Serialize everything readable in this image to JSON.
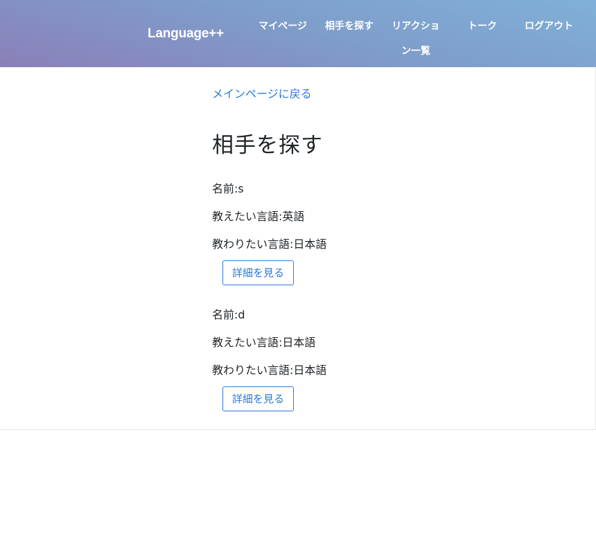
{
  "header": {
    "brand": "Language++",
    "nav": [
      {
        "label": "マイページ"
      },
      {
        "label": "相手を探す"
      },
      {
        "label_line1": "リアクショ",
        "label_line2": "ン一覧"
      },
      {
        "label": "トーク"
      },
      {
        "label": "ログアウト"
      }
    ]
  },
  "main": {
    "back_link": "メインページに戻る",
    "title": "相手を探す",
    "users": [
      {
        "name": "名前:s",
        "teach": "教えたい言語:英語",
        "learn": "教わりたい言語:日本語",
        "button": "詳細を見る"
      },
      {
        "name": "名前:d",
        "teach": "教えたい言語:日本語",
        "learn": "教わりたい言語:日本語",
        "button": "詳細を見る"
      }
    ]
  },
  "colors": {
    "accent": "#2a7ad8",
    "header_gradient_start": "#8b7fb8",
    "header_gradient_end": "#7fb0d8"
  }
}
